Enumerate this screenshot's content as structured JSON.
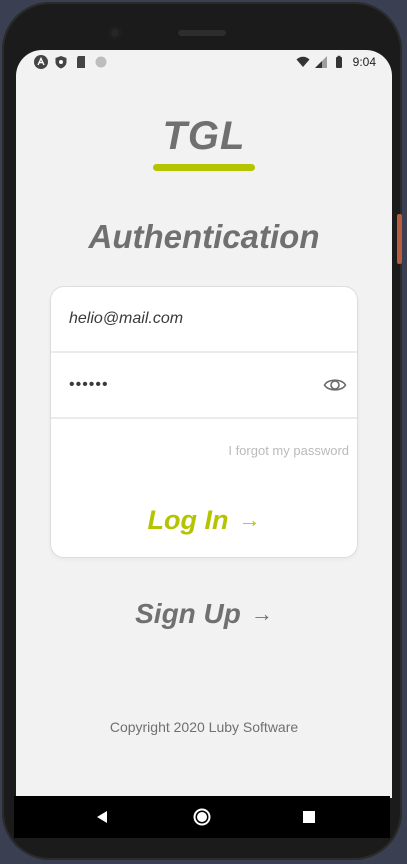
{
  "status_bar": {
    "time": "9:04",
    "left_icons": [
      "autofill-a-icon",
      "shield-icon",
      "sd-card-icon",
      "dot-icon"
    ],
    "right_icons": [
      "wifi-icon",
      "signal-icon",
      "battery-icon"
    ]
  },
  "logo": {
    "text": "TGL",
    "accent_color": "#b5c401"
  },
  "title": "Authentication",
  "form": {
    "email_value": "helio@mail.com",
    "password_value": "••••••",
    "forgot_label": "I forgot my password",
    "login_label": "Log In",
    "login_arrow": "→"
  },
  "signup": {
    "label": "Sign Up",
    "arrow": "→"
  },
  "footer": {
    "copyright": "Copyright 2020 Luby Software"
  },
  "colors": {
    "accent": "#b5c401",
    "text_gray": "#707070",
    "background": "#f2f2f2"
  }
}
